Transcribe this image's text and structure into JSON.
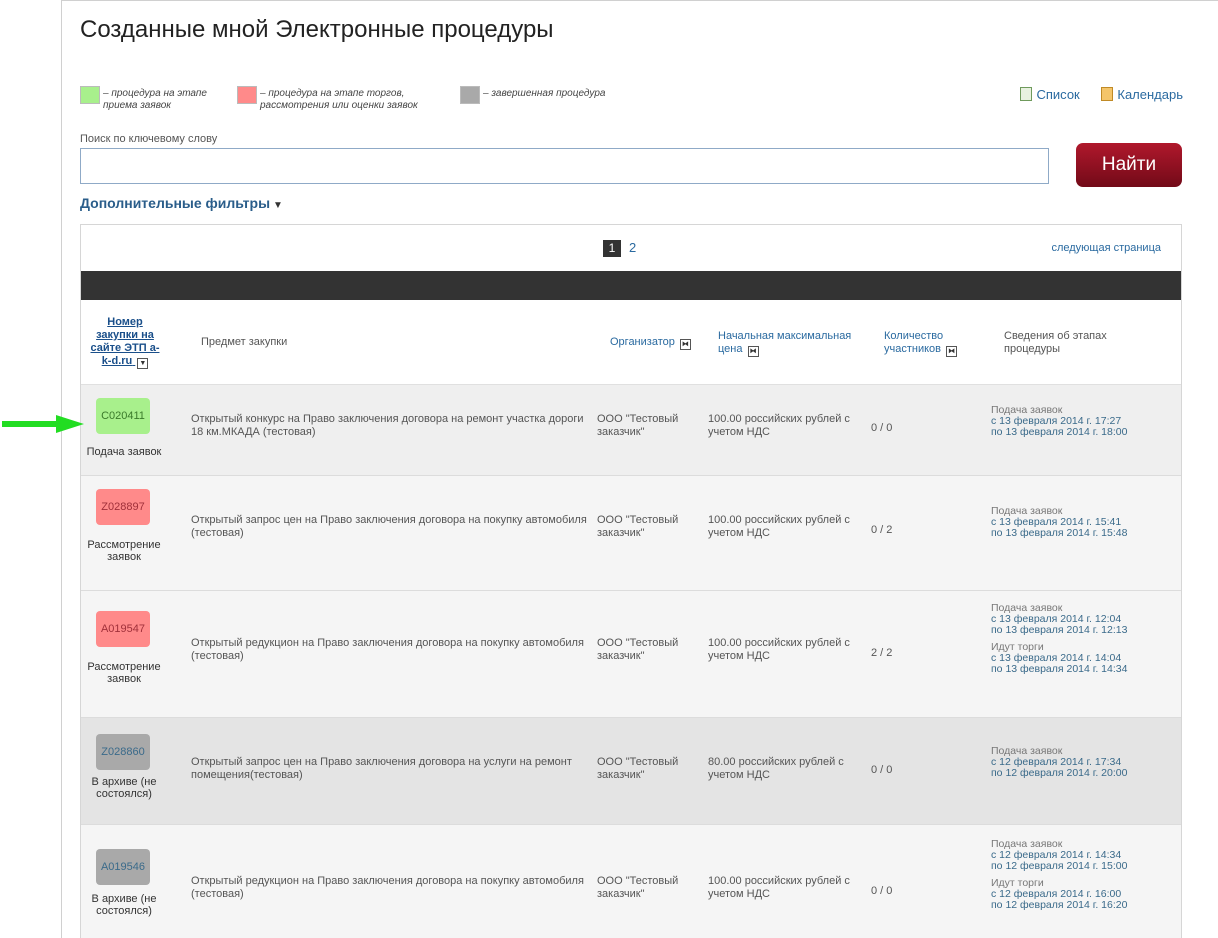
{
  "page": {
    "title": "Созданные мной Электронные процедуры"
  },
  "legend": [
    {
      "color": "#a8f08c",
      "text_line1": "– процедура на этапе",
      "text_line2": "приема заявок"
    },
    {
      "color": "#ff8a8a",
      "text_line1": "– процедура на этапе торгов,",
      "text_line2": "рассмотрения или оценки заявок"
    },
    {
      "color": "#a9a9a9",
      "text_line1": "– завершенная процедура",
      "text_line2": ""
    }
  ],
  "views": {
    "list_label": "Список",
    "calendar_label": "Календарь",
    "list_icon": "list-icon",
    "calendar_icon": "calendar-icon"
  },
  "search": {
    "label": "Поиск по ключевому слову",
    "value": "",
    "placeholder": "",
    "button_label": "Найти"
  },
  "filters": {
    "label": "Дополнительные фильтры"
  },
  "pagination": {
    "current": "1",
    "pages": [
      "1",
      "2"
    ],
    "next_label": "следующая страница"
  },
  "table": {
    "columns": {
      "number": "Номер закупки на сайте ЭТП a-k-d.ru",
      "subject": "Предмет закупки",
      "organizer": "Организатор",
      "price": "Начальная максимальная цена",
      "participants": "Количество участников",
      "stages": "Сведения об этапах процедуры"
    },
    "rows": [
      {
        "number": "C020411",
        "status_color": "#a8f08c",
        "status": "Подача заявок",
        "subject": "Открытый конкурс на Право заключения договора на ремонт участка дороги 18 км.МКАДА (тестовая)",
        "organizer": "ООО \"Тестовый заказчик\"",
        "price": "100.00 российских рублей с учетом НДС",
        "participants": "0 / 0",
        "stages": [
          {
            "name": "Подача заявок",
            "from": "с 13 февраля 2014 г. 17:27",
            "to": "по 13 февраля 2014 г. 18:00"
          }
        ]
      },
      {
        "number": "Z028897",
        "status_color": "#ff8a8a",
        "status": "Рассмотрение заявок",
        "subject": "Открытый запрос цен на Право заключения договора на покупку автомобиля (тестовая)",
        "organizer": "ООО \"Тестовый заказчик\"",
        "price": "100.00 российских рублей с учетом НДС",
        "participants": "0 / 2",
        "stages": [
          {
            "name": "Подача заявок",
            "from": "с 13 февраля 2014 г. 15:41",
            "to": "по 13 февраля 2014 г. 15:48"
          }
        ]
      },
      {
        "number": "A019547",
        "status_color": "#ff8a8a",
        "status": "Рассмотрение заявок",
        "subject": "Открытый редукцион на Право заключения договора на покупку автомобиля (тестовая)",
        "organizer": "ООО \"Тестовый заказчик\"",
        "price": "100.00 российских рублей с учетом НДС",
        "participants": "2 / 2",
        "stages": [
          {
            "name": "Подача заявок",
            "from": "с 13 февраля 2014 г. 12:04",
            "to": "по 13 февраля 2014 г. 12:13"
          },
          {
            "name": "Идут торги",
            "from": "с 13 февраля 2014 г. 14:04",
            "to": "по 13 февраля 2014 г. 14:34"
          }
        ]
      },
      {
        "number": "Z028860",
        "status_color": "#a9a9a9",
        "status": "В архиве (не состоялся)",
        "subject": "Открытый запрос цен на Право заключения договора на услуги на ремонт помещения(тестовая)",
        "organizer": "ООО \"Тестовый заказчик\"",
        "price": "80.00 российских рублей с учетом НДС",
        "participants": "0 / 0",
        "stages": [
          {
            "name": "Подача заявок",
            "from": "с 12 февраля 2014 г. 17:34",
            "to": "по 12 февраля 2014 г. 20:00"
          }
        ]
      },
      {
        "number": "A019546",
        "status_color": "#a9a9a9",
        "status": "В архиве (не состоялся)",
        "subject": "Открытый редукцион на Право заключения договора на покупку автомобиля (тестовая)",
        "organizer": "ООО \"Тестовый заказчик\"",
        "price": "100.00 российских рублей с учетом НДС",
        "participants": "0 / 0",
        "stages": [
          {
            "name": "Подача заявок",
            "from": "с 12 февраля 2014 г. 14:34",
            "to": "по 12 февраля 2014 г. 15:00"
          },
          {
            "name": "Идут торги",
            "from": "с 12 февраля 2014 г. 16:00",
            "to": "по 12 февраля 2014 г. 16:20"
          }
        ]
      }
    ]
  },
  "annotation": {
    "arrow_color": "#22dd22",
    "arrow_icon": "green-arrow-icon"
  }
}
